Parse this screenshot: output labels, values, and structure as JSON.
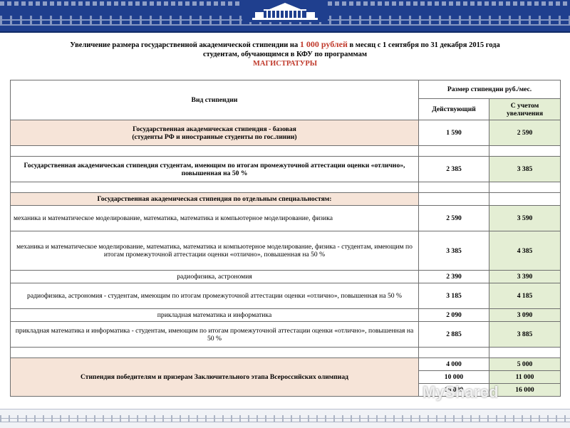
{
  "header": {
    "line1_prefix": "Увеличение размера государственной академической стипендии на",
    "amount": "1 000 рублей",
    "line1_suffix": "в месяц с 1 сентября по 31 декабря 2015 года",
    "line2": "студентам, обучающимся в КФУ по программам",
    "program": "МАГИСТРАТУРЫ"
  },
  "table": {
    "col_type": "Вид стипендии",
    "col_size": "Размер стипендии руб./мес.",
    "col_current": "Действующий",
    "col_increase": "С учетом увеличения",
    "rows": [
      {
        "label": "Государственная академическая стипендия - базовая\n(студенты РФ и иностранные студенты по гос.линии)",
        "current": "1 590",
        "increased": "2 590"
      },
      {
        "label": "Государственная академическая стипендия студентам, имеющим по итогам промежуточной аттестации оценки «отлично», повышенная на 50 %",
        "current": "2 385",
        "increased": "3 385"
      },
      {
        "label": "Государственная академическая стипендия по отдельным специальностям:"
      },
      {
        "label": "механика и математическое моделирование, математика, математика и компьютерное моделирование, физика",
        "current": "2 590",
        "increased": "3 590"
      },
      {
        "label": "механика и математическое моделирование, математика, математика и компьютерное моделирование, физика - студентам, имеющим по итогам промежуточной аттестации оценки «отлично», повышенная на 50 %",
        "current": "3 385",
        "increased": "4 385"
      },
      {
        "label": "радиофизика, астрономия",
        "current": "2 390",
        "increased": "3 390"
      },
      {
        "label": "радиофизика, астрономия - студентам, имеющим по итогам промежуточной аттестации оценки «отлично», повышенная на 50 %",
        "current": "3 185",
        "increased": "4 185"
      },
      {
        "label": "прикладная математика и информатика",
        "current": "2 090",
        "increased": "3 090"
      },
      {
        "label": "прикладная математика и информатика - студентам, имеющим по итогам промежуточной аттестации оценки «отлично», повышенная на 50 %",
        "current": "2 885",
        "increased": "3 885"
      },
      {
        "label": "Стипендия победителям и призерам Заключительного этапа Всероссийских олимпиад",
        "values": [
          {
            "current": "4 000",
            "increased": "5 000"
          },
          {
            "current": "10 000",
            "increased": "11 000"
          },
          {
            "current": "15 000",
            "increased": "16 000"
          }
        ]
      }
    ]
  },
  "watermark": "MyShared",
  "colors": {
    "band": "#1f3f8e",
    "accent": "#c0392b",
    "pink_cell": "#f6e4d8",
    "green_cell": "#e4eed4"
  }
}
